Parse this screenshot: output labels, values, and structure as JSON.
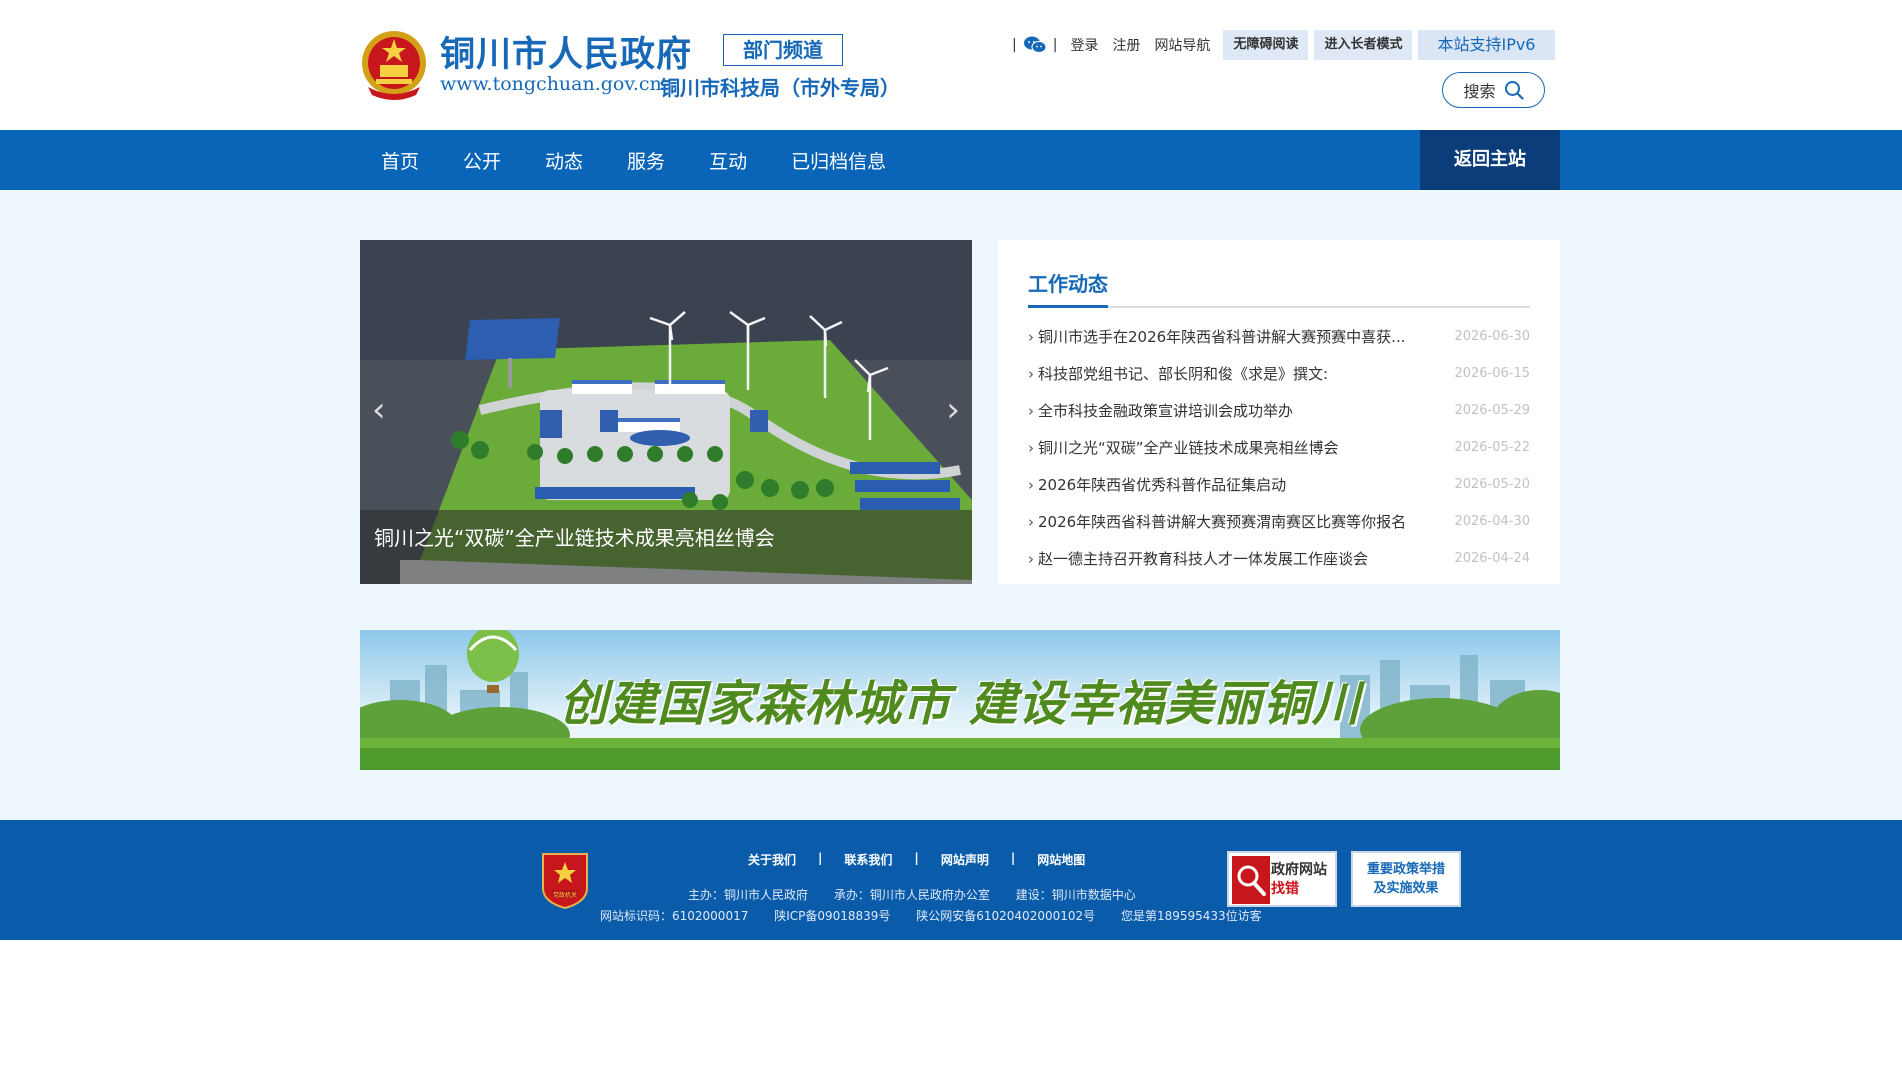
{
  "header": {
    "site_title": "铜川市人民政府",
    "channel_badge": "部门频道",
    "site_url": "www.tongchuan.gov.cn",
    "dept_name": "铜川市科技局（市外专局）",
    "top_links": {
      "login": "登录",
      "register": "注册",
      "site_nav": "网站导航",
      "accessible_read": "无障碍阅读",
      "elder_mode": "进入长者模式",
      "ipv6": "本站支持IPv6"
    },
    "search_label": "搜索"
  },
  "nav": {
    "items": [
      {
        "label": "首页"
      },
      {
        "label": "公开"
      },
      {
        "label": "动态"
      },
      {
        "label": "服务"
      },
      {
        "label": "互动"
      },
      {
        "label": "已归档信息"
      }
    ],
    "return_home": "返回主站"
  },
  "carousel": {
    "caption": "铜川之光“双碳”全产业链技术成果亮相丝博会",
    "prev_icon": "chevron-left-icon",
    "next_icon": "chevron-right-icon"
  },
  "news": {
    "title": "工作动态",
    "items": [
      {
        "title": "铜川市选手在2026年陕西省科普讲解大赛预赛中喜获...",
        "date": "2026-06-30"
      },
      {
        "title": "科技部党组书记、部长阴和俊《求是》撰文:",
        "date": "2026-06-15"
      },
      {
        "title": "全市科技金融政策宣讲培训会成功举办",
        "date": "2026-05-29"
      },
      {
        "title": "铜川之光“双碳”全产业链技术成果亮相丝博会",
        "date": "2026-05-22"
      },
      {
        "title": "2026年陕西省优秀科普作品征集启动",
        "date": "2026-05-20"
      },
      {
        "title": "2026年陕西省科普讲解大赛预赛渭南赛区比赛等你报名",
        "date": "2026-04-30"
      },
      {
        "title": "赵一德主持召开教育科技人才一体发展工作座谈会",
        "date": "2026-04-24"
      }
    ]
  },
  "banner": {
    "text": "创建国家森林城市  建设幸福美丽铜川"
  },
  "footer": {
    "links": [
      {
        "label": "关于我们"
      },
      {
        "label": "联系我们"
      },
      {
        "label": "网站声明"
      },
      {
        "label": "网站地图"
      }
    ],
    "sponsor": "主办：铜川市人民政府",
    "organizer": "承办：铜川市人民政府办公室",
    "builder": "建设：铜川市数据中心",
    "site_code": "网站标识码：6102000017",
    "icp": "陕ICP备09018839号",
    "police_record": "陕公网安备61020402000102号",
    "visitor_count": "您是第189595433位访客",
    "badge_text": "党政机关",
    "find_error_line1": "政府网站",
    "find_error_line2": "找错",
    "policy_line1": "重要政策举措",
    "policy_line2": "及实施效果"
  },
  "colors": {
    "primary_blue": "#1769b8",
    "nav_blue": "#0a64b8",
    "nav_dark": "#0a3d7a",
    "footer_blue": "#0a5cab",
    "page_bg": "#eef7fd"
  }
}
